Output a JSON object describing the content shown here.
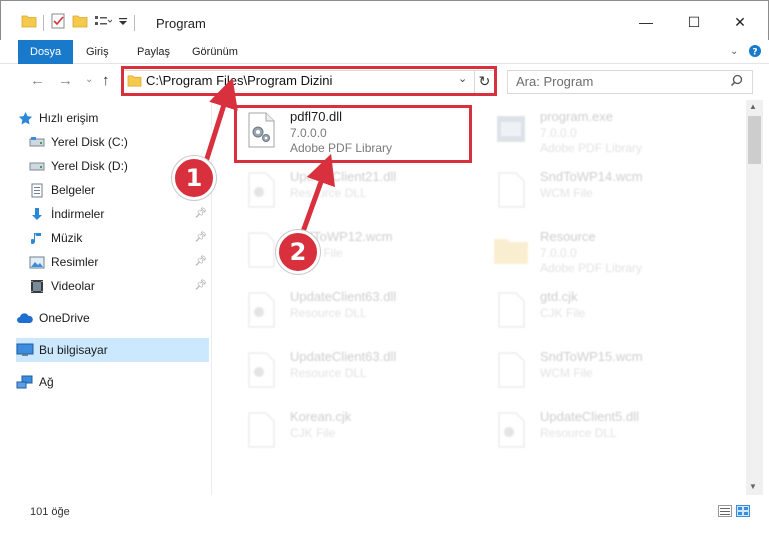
{
  "window": {
    "title": "Program",
    "minimize_glyph": "—",
    "maximize_glyph": "☐",
    "close_glyph": "✕"
  },
  "ribbon": {
    "tabs": [
      "Dosya",
      "Giriş",
      "Paylaş",
      "Görünüm"
    ]
  },
  "address": {
    "path": "C:\\Program Files\\Program Dizini"
  },
  "search": {
    "placeholder": "Ara: Program"
  },
  "sidebar": {
    "items": [
      {
        "label": "Hızlı erişim",
        "icon": "star-icon"
      },
      {
        "label": "Yerel Disk (C:)",
        "icon": "drive-icon"
      },
      {
        "label": "Yerel Disk (D:)",
        "icon": "drive-icon"
      },
      {
        "label": "Belgeler",
        "icon": "document-icon",
        "pinned": true
      },
      {
        "label": "İndirmeler",
        "icon": "download-icon",
        "pinned": true
      },
      {
        "label": "Müzik",
        "icon": "music-icon",
        "pinned": true
      },
      {
        "label": "Resimler",
        "icon": "pictures-icon",
        "pinned": true
      },
      {
        "label": "Videolar",
        "icon": "video-icon",
        "pinned": true
      },
      {
        "label": "OneDrive",
        "icon": "cloud-icon"
      },
      {
        "label": "Bu bilgisayar",
        "icon": "computer-icon",
        "selected": true
      },
      {
        "label": "Ağ",
        "icon": "network-icon"
      }
    ]
  },
  "files": [
    {
      "name": "pdfl70.dll",
      "line1": "7.0.0.0",
      "line2": "Adobe PDF Library",
      "highlight": true,
      "icon": "dll-gear-icon"
    },
    {
      "name": "program.exe",
      "line1": "7.0.0.0",
      "line2": "Adobe PDF Library",
      "icon": "exe-icon"
    },
    {
      "name": "UpdateClient21.dll",
      "line1": "Resource DLL",
      "icon": "dll-gear-icon"
    },
    {
      "name": "SndToWP14.wcm",
      "line1": "WCM File",
      "icon": "blank-file-icon"
    },
    {
      "name": "SndToWP12.wcm",
      "line1": "WCM File",
      "icon": "blank-file-icon"
    },
    {
      "name": "Resource",
      "line1": "7.0.0.0",
      "line2": "Adobe PDF Library",
      "icon": "folder-icon"
    },
    {
      "name": "UpdateClient63.dll",
      "line1": "Resource DLL",
      "icon": "dll-gear-icon"
    },
    {
      "name": "gtd.cjk",
      "line1": "CJK File",
      "icon": "blank-file-icon"
    },
    {
      "name": "UpdateClient63.dll",
      "line1": "Resource DLL",
      "icon": "dll-gear-icon"
    },
    {
      "name": "SndToWP15.wcm",
      "line1": "WCM File",
      "icon": "blank-file-icon"
    },
    {
      "name": "Korean.cjk",
      "line1": "CJK File",
      "icon": "blank-file-icon"
    },
    {
      "name": "UpdateClient5.dll",
      "line1": "Resource DLL",
      "icon": "dll-gear-icon"
    }
  ],
  "status": {
    "count": "101 öğe"
  },
  "annotations": {
    "step1": "1",
    "step2": "2",
    "color": "#d8303d"
  },
  "colors": {
    "accent": "#1979ca",
    "selection": "#cce8ff",
    "highlight_box": "#d8303d"
  }
}
